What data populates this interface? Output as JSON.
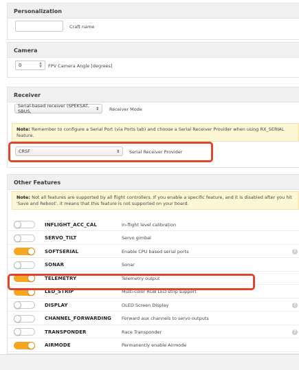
{
  "personalization": {
    "title": "Personalization",
    "craft_name_label": "Craft name",
    "craft_name_value": ""
  },
  "camera": {
    "title": "Camera",
    "angle_value": "0",
    "angle_label": "FPV Camera Angle [degrees]"
  },
  "receiver": {
    "title": "Receiver",
    "mode_value": "Serial-based receiver (SPEKSAT, SBUS, ",
    "mode_label": "Receiver Mode",
    "note_bold": "Note:",
    "note_text": " Remember to configure a Serial Port (via Ports tab) and choose a Serial Receiver Provider when using RX_SERIAL feature.",
    "provider_value": "CRSF",
    "provider_label": "Serial Receiver Provider"
  },
  "other": {
    "title": "Other Features",
    "note_bold": "Note:",
    "note_text": " Not all features are supported by all flight controllers. If you enable a specific feature, and it is disabled after you hit 'Save and Reboot', it means that this feature is not supported on your board.",
    "features": [
      {
        "name": "INFLIGHT_ACC_CAL",
        "desc": "In-flight level calibration",
        "enabled": false,
        "help": false
      },
      {
        "name": "SERVO_TILT",
        "desc": "Servo gimbal",
        "enabled": false,
        "help": false
      },
      {
        "name": "SOFTSERIAL",
        "desc": "Enable CPU based serial ports",
        "enabled": true,
        "help": true
      },
      {
        "name": "SONAR",
        "desc": "Sonar",
        "enabled": false,
        "help": false
      },
      {
        "name": "TELEMETRY",
        "desc": "Telemetry output",
        "enabled": true,
        "help": false
      },
      {
        "name": "LED_STRIP",
        "desc": "Multi-color RGB LED strip support",
        "enabled": true,
        "help": false
      },
      {
        "name": "DISPLAY",
        "desc": "OLED Screen Display",
        "enabled": false,
        "help": true
      },
      {
        "name": "CHANNEL_FORWARDING",
        "desc": "Forward aux channels to servo outputs",
        "enabled": false,
        "help": false
      },
      {
        "name": "TRANSPONDER",
        "desc": "Race Transponder",
        "enabled": false,
        "help": true
      },
      {
        "name": "AIRMODE",
        "desc": "Permanently enable Airmode",
        "enabled": true,
        "help": false
      }
    ]
  },
  "colors": {
    "accent": "#f5a623",
    "highlight": "#e0442c",
    "note_bg": "#fdf7d6"
  }
}
